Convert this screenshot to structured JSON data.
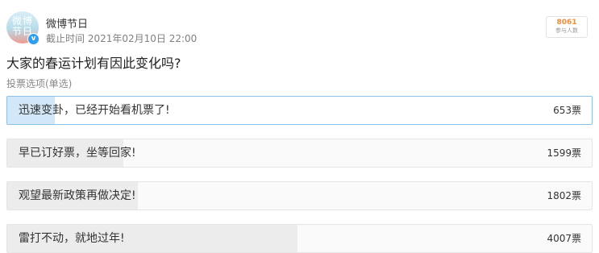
{
  "account": {
    "name": "微博节日",
    "avatar_text": "微博\n节日",
    "verified_badge": "v"
  },
  "deadline": "截止时间 2021年02月10日 22:00",
  "participants": {
    "count": "8061",
    "label": "参与人数"
  },
  "question": "大家的春运计划有因此变化吗?",
  "vote_type": "投票选项(单选)",
  "options": [
    {
      "text": "迅速变卦，已经开始看机票了!",
      "count": "653票",
      "votes": 653,
      "selected": true
    },
    {
      "text": "早已订好票，坐等回家!",
      "count": "1599票",
      "votes": 1599,
      "selected": false
    },
    {
      "text": "观望最新政策再做决定!",
      "count": "1802票",
      "votes": 1802,
      "selected": false
    },
    {
      "text": "雷打不动，就地过年!",
      "count": "4007票",
      "votes": 4007,
      "selected": false
    }
  ],
  "colors": {
    "selected_border": "#8cc2e8",
    "selected_fill": "#d2e7f7",
    "fill": "#ececec",
    "participants_count": "#f28b3a"
  }
}
